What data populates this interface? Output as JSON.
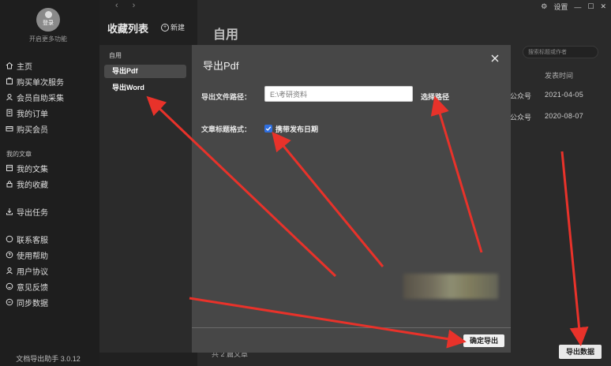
{
  "sidebar": {
    "avatar_label": "登录",
    "vip_text": "开启更多功能",
    "main_items": [
      {
        "label": "主页",
        "icon": "home-icon"
      },
      {
        "label": "购买单次服务",
        "icon": "cart-icon"
      },
      {
        "label": "会员自助采集",
        "icon": "user-icon"
      },
      {
        "label": "我的订单",
        "icon": "order-icon"
      },
      {
        "label": "购买会员",
        "icon": "vip-icon"
      }
    ],
    "articles_section": "我的文章",
    "article_items": [
      {
        "label": "我的文集",
        "icon": "collection-icon"
      },
      {
        "label": "我的收藏",
        "icon": "lock-icon"
      }
    ],
    "task_item": {
      "label": "导出任务",
      "icon": "download-icon"
    },
    "help_items": [
      {
        "label": "联系客服",
        "icon": "chat-icon"
      },
      {
        "label": "使用帮助",
        "icon": "help-icon"
      },
      {
        "label": "用户协议",
        "icon": "user-icon"
      },
      {
        "label": "意见反馈",
        "icon": "feedback-icon"
      },
      {
        "label": "同步数据",
        "icon": "sync-icon"
      }
    ],
    "version": "文档导出助手 3.0.12"
  },
  "favorites": {
    "title": "收藏列表",
    "new_label": "新建"
  },
  "main": {
    "title": "自用",
    "settings_label": "设置",
    "search_placeholder": "搜索标题或作者",
    "col_date": "发表时间",
    "rows": [
      {
        "source": "公众号",
        "date": "2021-04-05"
      },
      {
        "source": "公众号",
        "date": "2020-08-07"
      }
    ],
    "footer_count": "共 2 篇文章",
    "export_data_label": "导出数据"
  },
  "modal": {
    "category": "自用",
    "options": [
      {
        "label": "导出Pdf",
        "active": true
      },
      {
        "label": "导出Word",
        "active": false
      }
    ],
    "title": "导出Pdf",
    "path_label": "导出文件路径：",
    "path_value": "E:\\考研资料",
    "choose_path_label": "选择路径",
    "title_format_label": "文章标题格式：",
    "checkbox_label": "携带发布日期",
    "checkbox_checked": true,
    "confirm_label": "确定导出"
  },
  "colors": {
    "checkbox": "#2f6fe0",
    "arrow": "#e8322a"
  }
}
